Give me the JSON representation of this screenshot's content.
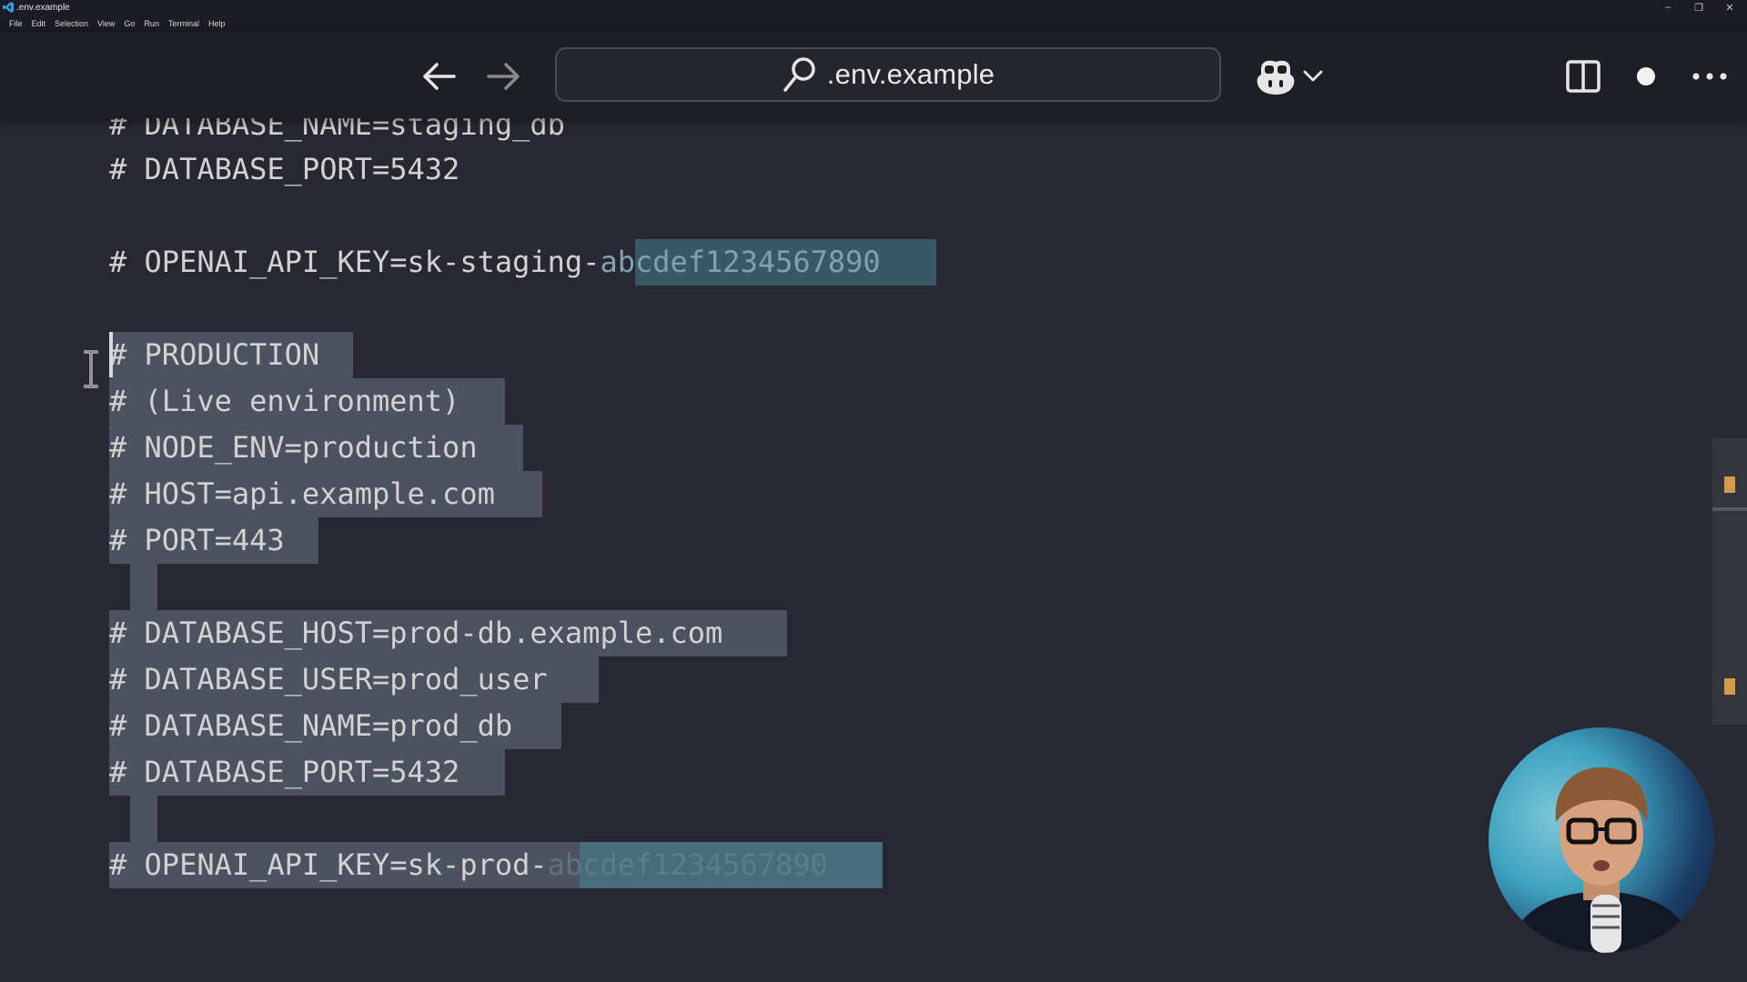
{
  "window": {
    "title": ".env.example",
    "menu": [
      "File",
      "Edit",
      "Selection",
      "View",
      "Go",
      "Run",
      "Terminal",
      "Help"
    ],
    "controls": [
      "–",
      "❐",
      "✕"
    ]
  },
  "commandbar": {
    "search_text": ".env.example",
    "back_icon": "arrow-left-icon",
    "forward_icon": "arrow-right-icon",
    "copilot_icon": "copilot-icon",
    "layout_icon": "split-editor-icon",
    "unsaved_icon": "dot-icon",
    "more_icon": "ellipsis-icon"
  },
  "editor": {
    "lines": [
      {
        "text": "# DATABASE_NAME=staging_db"
      },
      {
        "text": "# DATABASE_PORT=5432"
      },
      {
        "text": ""
      },
      {
        "prefix": "# OPENAI_API_KEY=sk-staging-",
        "highlight": "abcdef1234567890"
      },
      {
        "text": ""
      },
      {
        "text": "# PRODUCTION"
      },
      {
        "text": "# (Live environment)"
      },
      {
        "text": "# NODE_ENV=production"
      },
      {
        "text": "# HOST=api.example.com"
      },
      {
        "text": "# PORT=443"
      },
      {
        "text": ""
      },
      {
        "text": "# DATABASE_HOST=prod-db.example.com"
      },
      {
        "text": "# DATABASE_USER=prod_user"
      },
      {
        "text": "# DATABASE_NAME=prod_db"
      },
      {
        "text": "# DATABASE_PORT=5432"
      },
      {
        "text": ""
      },
      {
        "prefix": "# OPENAI_API_KEY=sk-prod-",
        "highlight": "abcdef1234567890"
      }
    ]
  },
  "colors": {
    "background": "#272831",
    "selection": "#4d5260",
    "find_match": "#44828f",
    "scroll_marker": "#d69a4c"
  },
  "webcam": {
    "icon": "presenter-webcam"
  }
}
